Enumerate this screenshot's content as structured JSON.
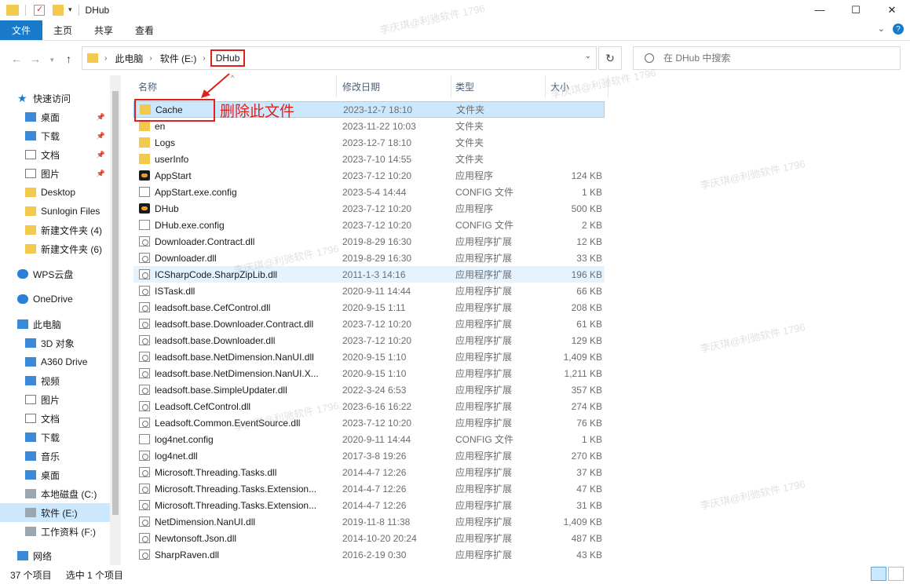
{
  "window": {
    "title": "DHub",
    "minimize": "—",
    "maximize": "☐",
    "close": "✕"
  },
  "ribbon": {
    "tabs": [
      "文件",
      "主页",
      "共享",
      "查看"
    ]
  },
  "address": {
    "crumbs": [
      "此电脑",
      "软件 (E:)",
      "DHub"
    ],
    "search_placeholder": "在 DHub 中搜索"
  },
  "columns": {
    "name": "名称",
    "date": "修改日期",
    "type": "类型",
    "size": "大小"
  },
  "sidebar": {
    "items": [
      {
        "label": "快速访问",
        "icon": "star-icon",
        "pinned": false
      },
      {
        "label": "桌面",
        "icon": "desktop-icon",
        "pinned": true
      },
      {
        "label": "下载",
        "icon": "download-icon",
        "pinned": true
      },
      {
        "label": "文档",
        "icon": "document-icon",
        "pinned": true
      },
      {
        "label": "图片",
        "icon": "picture-icon",
        "pinned": true
      },
      {
        "label": "Desktop",
        "icon": "folder-icon",
        "pinned": false
      },
      {
        "label": "Sunlogin Files",
        "icon": "folder-icon",
        "pinned": false
      },
      {
        "label": "新建文件夹 (4)",
        "icon": "folder-icon",
        "pinned": false
      },
      {
        "label": "新建文件夹 (6)",
        "icon": "folder-icon",
        "pinned": false
      },
      {
        "label": "WPS云盘",
        "icon": "wps-cloud-icon",
        "pinned": false
      },
      {
        "label": "OneDrive",
        "icon": "onedrive-icon",
        "pinned": false
      },
      {
        "label": "此电脑",
        "icon": "pc-icon",
        "pinned": false
      },
      {
        "label": "3D 对象",
        "icon": "3d-objects-icon",
        "pinned": false
      },
      {
        "label": "A360 Drive",
        "icon": "a360-drive-icon",
        "pinned": false
      },
      {
        "label": "视频",
        "icon": "video-icon",
        "pinned": false
      },
      {
        "label": "图片",
        "icon": "picture-icon",
        "pinned": false
      },
      {
        "label": "文档",
        "icon": "document-icon",
        "pinned": false
      },
      {
        "label": "下载",
        "icon": "download-icon",
        "pinned": false
      },
      {
        "label": "音乐",
        "icon": "music-icon",
        "pinned": false
      },
      {
        "label": "桌面",
        "icon": "desktop-icon",
        "pinned": false
      },
      {
        "label": "本地磁盘 (C:)",
        "icon": "drive-icon",
        "pinned": false
      },
      {
        "label": "软件 (E:)",
        "icon": "drive-icon",
        "pinned": false,
        "selected": true
      },
      {
        "label": "工作资料 (F:)",
        "icon": "drive-icon",
        "pinned": false
      },
      {
        "label": "网络",
        "icon": "network-icon",
        "pinned": false
      }
    ]
  },
  "files": [
    {
      "name": "Cache",
      "date": "2023-12-7 18:10",
      "type": "文件夹",
      "size": "",
      "icon": "folder-icon",
      "selected": true
    },
    {
      "name": "en",
      "date": "2023-11-22 10:03",
      "type": "文件夹",
      "size": "",
      "icon": "folder-icon"
    },
    {
      "name": "Logs",
      "date": "2023-12-7 18:10",
      "type": "文件夹",
      "size": "",
      "icon": "folder-icon"
    },
    {
      "name": "userInfo",
      "date": "2023-7-10 14:55",
      "type": "文件夹",
      "size": "",
      "icon": "folder-icon"
    },
    {
      "name": "AppStart",
      "date": "2023-7-12 10:20",
      "type": "应用程序",
      "size": "124 KB",
      "icon": "app-icon"
    },
    {
      "name": "AppStart.exe.config",
      "date": "2023-5-4 14:44",
      "type": "CONFIG 文件",
      "size": "1 KB",
      "icon": "file-icon"
    },
    {
      "name": "DHub",
      "date": "2023-7-12 10:20",
      "type": "应用程序",
      "size": "500 KB",
      "icon": "app-icon"
    },
    {
      "name": "DHub.exe.config",
      "date": "2023-7-12 10:20",
      "type": "CONFIG 文件",
      "size": "2 KB",
      "icon": "file-icon"
    },
    {
      "name": "Downloader.Contract.dll",
      "date": "2019-8-29 16:30",
      "type": "应用程序扩展",
      "size": "12 KB",
      "icon": "dll-icon"
    },
    {
      "name": "Downloader.dll",
      "date": "2019-8-29 16:30",
      "type": "应用程序扩展",
      "size": "33 KB",
      "icon": "dll-icon"
    },
    {
      "name": "ICSharpCode.SharpZipLib.dll",
      "date": "2011-1-3 14:16",
      "type": "应用程序扩展",
      "size": "196 KB",
      "icon": "dll-icon",
      "hover": true
    },
    {
      "name": "ISTask.dll",
      "date": "2020-9-11 14:44",
      "type": "应用程序扩展",
      "size": "66 KB",
      "icon": "dll-icon"
    },
    {
      "name": "leadsoft.base.CefControl.dll",
      "date": "2020-9-15 1:11",
      "type": "应用程序扩展",
      "size": "208 KB",
      "icon": "dll-icon"
    },
    {
      "name": "leadsoft.base.Downloader.Contract.dll",
      "date": "2023-7-12 10:20",
      "type": "应用程序扩展",
      "size": "61 KB",
      "icon": "dll-icon"
    },
    {
      "name": "leadsoft.base.Downloader.dll",
      "date": "2023-7-12 10:20",
      "type": "应用程序扩展",
      "size": "129 KB",
      "icon": "dll-icon"
    },
    {
      "name": "leadsoft.base.NetDimension.NanUI.dll",
      "date": "2020-9-15 1:10",
      "type": "应用程序扩展",
      "size": "1,409 KB",
      "icon": "dll-icon"
    },
    {
      "name": "leadsoft.base.NetDimension.NanUI.X...",
      "date": "2020-9-15 1:10",
      "type": "应用程序扩展",
      "size": "1,211 KB",
      "icon": "dll-icon"
    },
    {
      "name": "leadsoft.base.SimpleUpdater.dll",
      "date": "2022-3-24 6:53",
      "type": "应用程序扩展",
      "size": "357 KB",
      "icon": "dll-icon"
    },
    {
      "name": "Leadsoft.CefControl.dll",
      "date": "2023-6-16 16:22",
      "type": "应用程序扩展",
      "size": "274 KB",
      "icon": "dll-icon"
    },
    {
      "name": "Leadsoft.Common.EventSource.dll",
      "date": "2023-7-12 10:20",
      "type": "应用程序扩展",
      "size": "76 KB",
      "icon": "dll-icon"
    },
    {
      "name": "log4net.config",
      "date": "2020-9-11 14:44",
      "type": "CONFIG 文件",
      "size": "1 KB",
      "icon": "file-icon"
    },
    {
      "name": "log4net.dll",
      "date": "2017-3-8 19:26",
      "type": "应用程序扩展",
      "size": "270 KB",
      "icon": "dll-icon"
    },
    {
      "name": "Microsoft.Threading.Tasks.dll",
      "date": "2014-4-7 12:26",
      "type": "应用程序扩展",
      "size": "37 KB",
      "icon": "dll-icon"
    },
    {
      "name": "Microsoft.Threading.Tasks.Extension...",
      "date": "2014-4-7 12:26",
      "type": "应用程序扩展",
      "size": "47 KB",
      "icon": "dll-icon"
    },
    {
      "name": "Microsoft.Threading.Tasks.Extension...",
      "date": "2014-4-7 12:26",
      "type": "应用程序扩展",
      "size": "31 KB",
      "icon": "dll-icon"
    },
    {
      "name": "NetDimension.NanUI.dll",
      "date": "2019-11-8 11:38",
      "type": "应用程序扩展",
      "size": "1,409 KB",
      "icon": "dll-icon"
    },
    {
      "name": "Newtonsoft.Json.dll",
      "date": "2014-10-20 20:24",
      "type": "应用程序扩展",
      "size": "487 KB",
      "icon": "dll-icon"
    },
    {
      "name": "SharpRaven.dll",
      "date": "2016-2-19 0:30",
      "type": "应用程序扩展",
      "size": "43 KB",
      "icon": "dll-icon"
    }
  ],
  "annotation": {
    "text": "删除此文件",
    "color": "#e0201b"
  },
  "status": {
    "count": "37 个项目",
    "selected": "选中 1 个项目"
  },
  "watermark": "李庆琪@利驰软件 1796",
  "colors": {
    "accent": "#1979ca",
    "selection": "#cce8ff",
    "folder": "#f3c94d"
  }
}
